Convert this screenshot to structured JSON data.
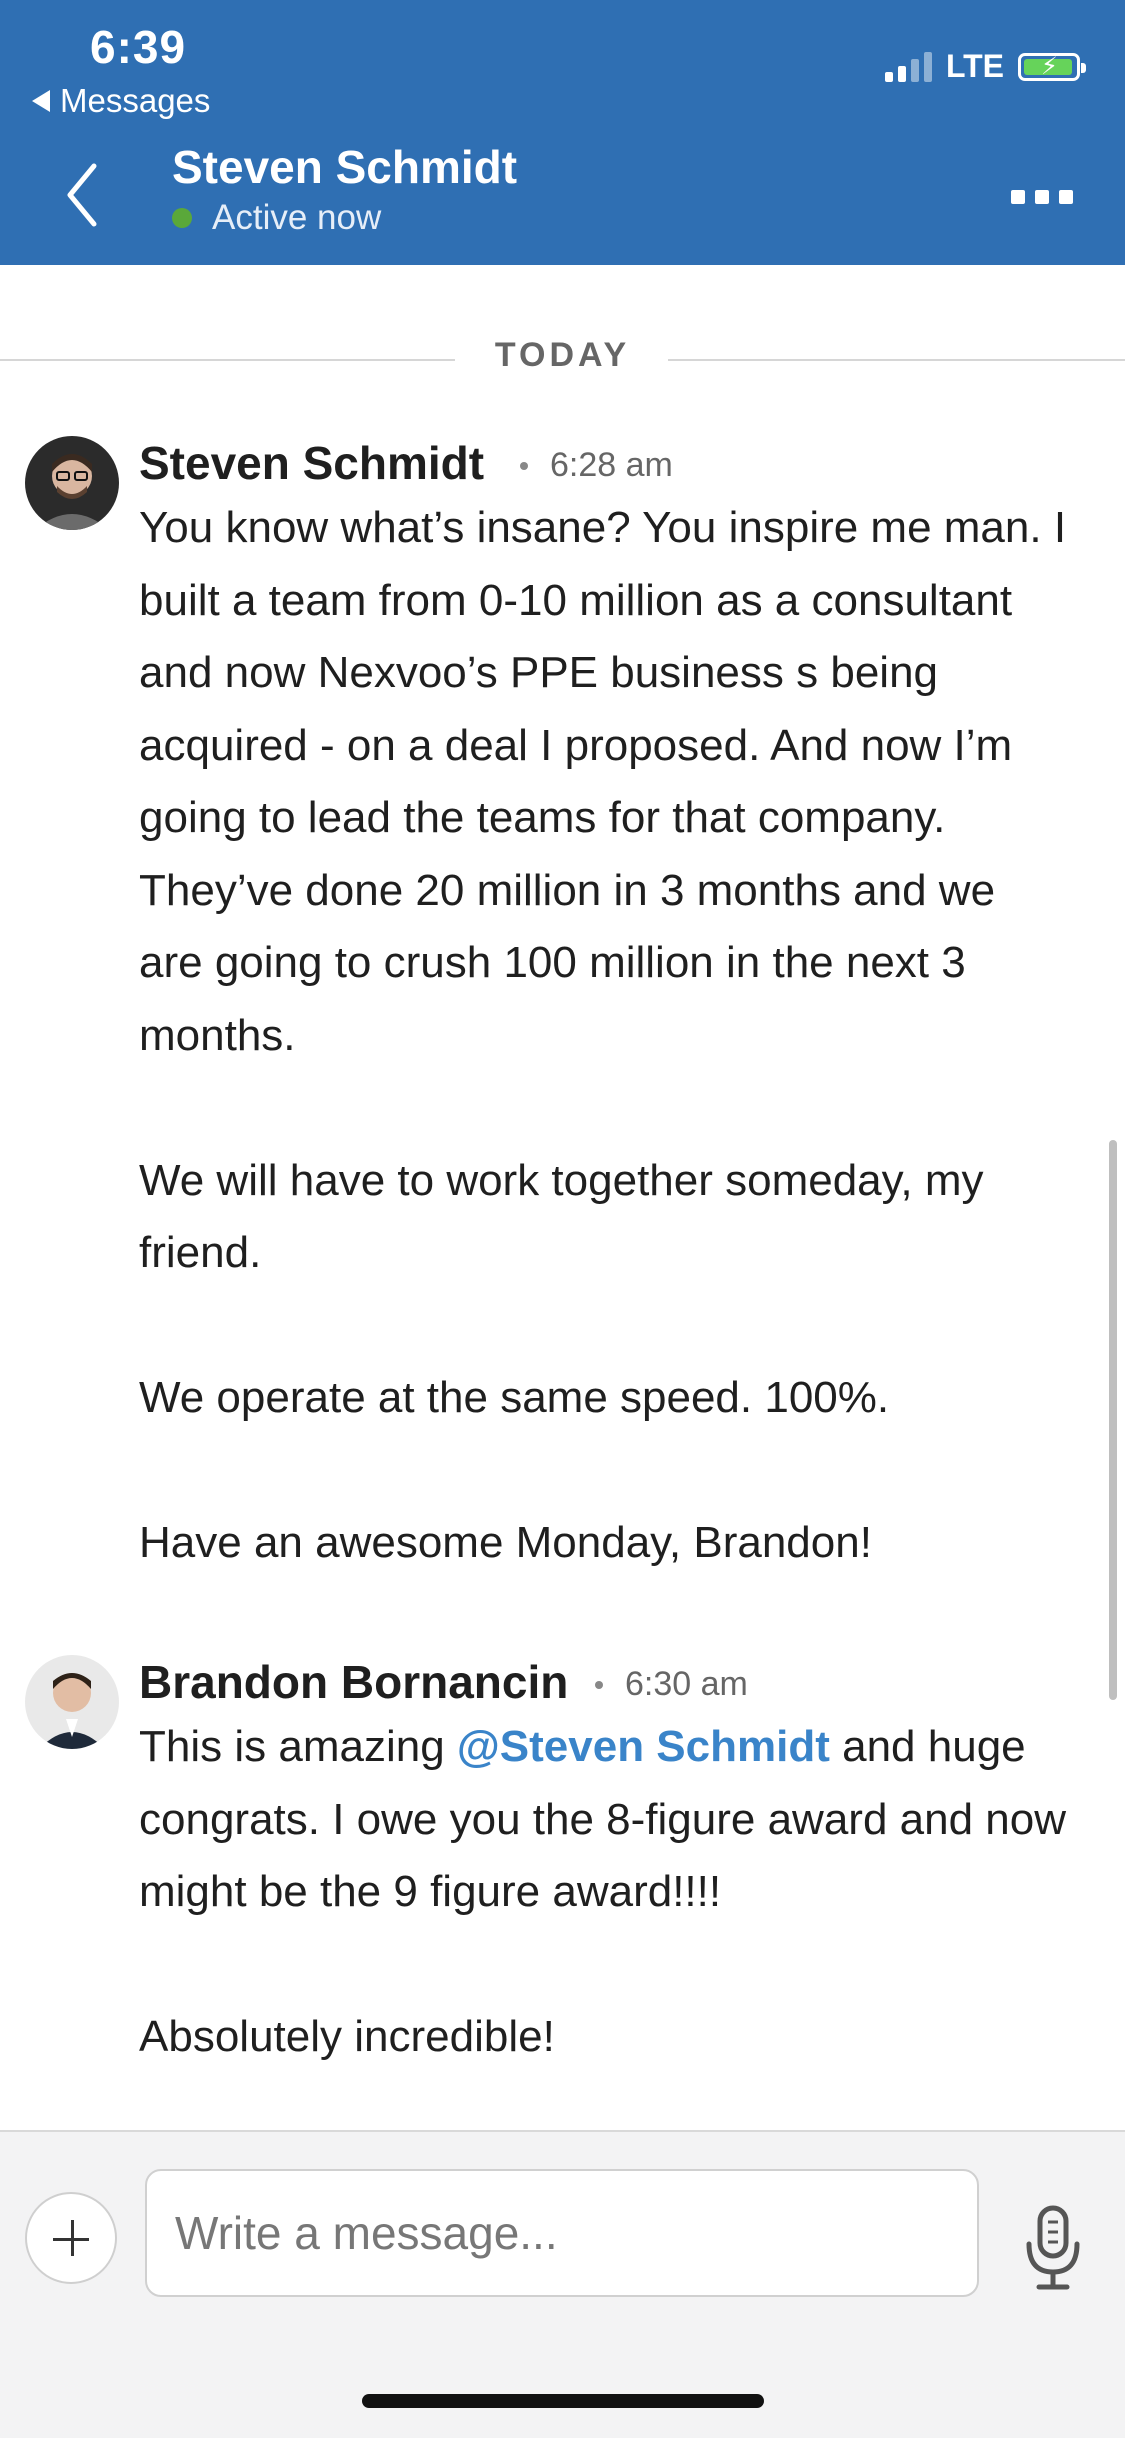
{
  "status_bar": {
    "time": "6:39",
    "back_app": "Messages",
    "network": "LTE"
  },
  "header": {
    "contact_name": "Steven Schmidt",
    "presence": "Active now"
  },
  "divider": {
    "label": "TODAY"
  },
  "messages": [
    {
      "sender": "Steven Schmidt",
      "time": "6:28 am",
      "paragraphs": [
        "You know what’s insane?  You inspire me man.  I built a team from 0-10 million as a consultant and now Nexvoo’s PPE business s being acquired - on a deal I proposed.  And now I’m going to lead the teams for that company.  They’ve done 20 million in 3 months and we are going to crush 100 million in the next 3 months.",
        "We will have to work together someday, my friend.",
        "We operate at the same speed. 100%.",
        "Have an awesome Monday, Brandon!"
      ]
    },
    {
      "sender": "Brandon Bornancin",
      "time": "6:30 am",
      "p1_before": "This is amazing ",
      "mention": "@Steven Schmidt",
      "p1_after": " and huge congrats. I owe you the 8-figure award and now might be the 9 figure award!!!!",
      "p2": "Absolutely incredible!"
    }
  ],
  "composer": {
    "placeholder": "Write a message..."
  },
  "colors": {
    "header_bg": "#2f6fb3",
    "presence_green": "#5aa83a",
    "mention_blue": "#3a84c9",
    "battery_green": "#66d35a"
  },
  "icons": [
    "back-chevron-icon",
    "more-icon",
    "plus-icon",
    "mic-icon",
    "signal-icon",
    "battery-icon"
  ]
}
